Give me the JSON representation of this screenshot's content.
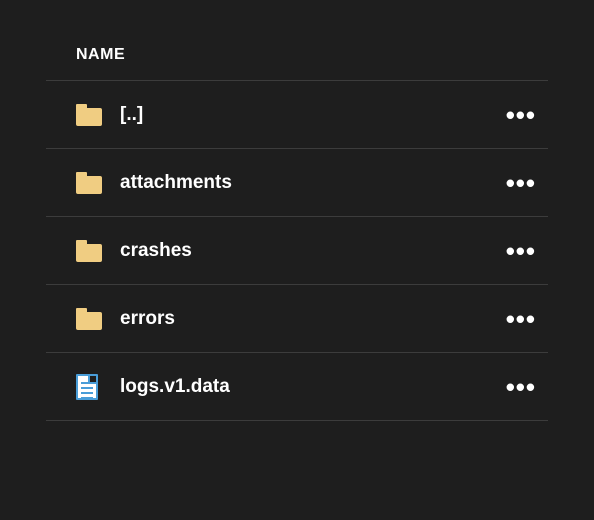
{
  "header": {
    "name_column": "NAME"
  },
  "icons": {
    "folder": "folder-icon",
    "file": "file-icon",
    "more": "•••"
  },
  "rows": [
    {
      "type": "folder",
      "name": "[..]"
    },
    {
      "type": "folder",
      "name": "attachments"
    },
    {
      "type": "folder",
      "name": "crashes"
    },
    {
      "type": "folder",
      "name": "errors"
    },
    {
      "type": "file",
      "name": "logs.v1.data"
    }
  ]
}
